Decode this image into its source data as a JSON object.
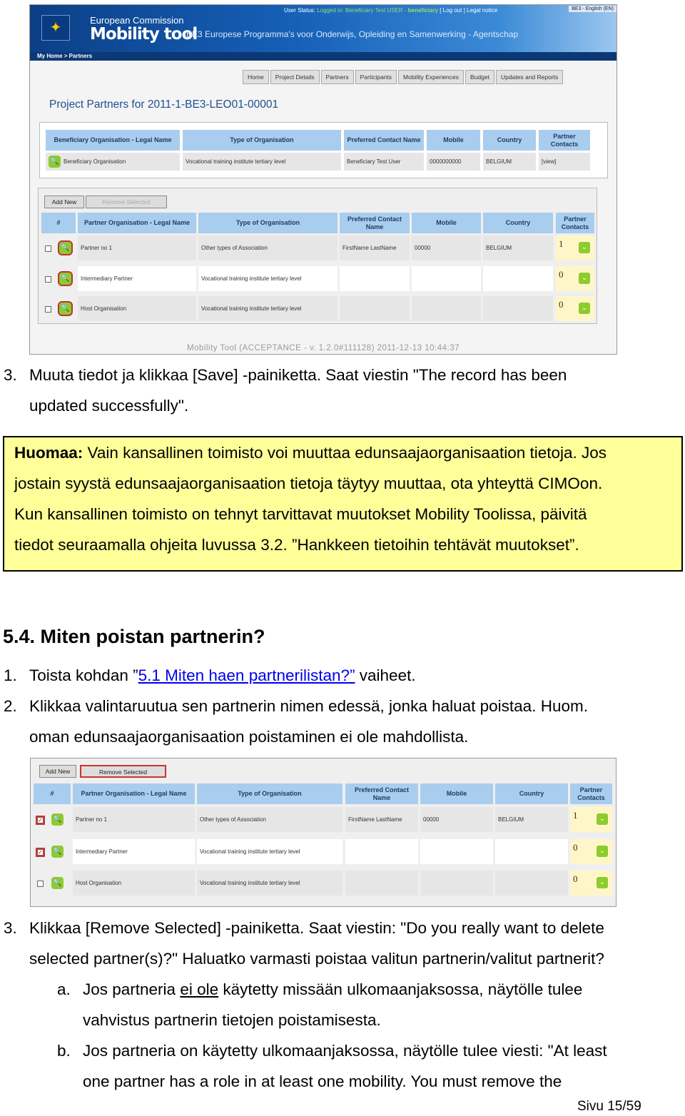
{
  "shot1": {
    "user_status_label": "User Status:",
    "logged_in": "Logged in: Beneficiary Test USER -",
    "user_role": "beneficiary",
    "logout": "[  Log out  ]",
    "legal": "Legal notice",
    "language": "BE3 - English (EN)",
    "ec": "European Commission",
    "app": "Mobility tool",
    "agency": "BE3 Europese Programma's voor Onderwijs, Opleiding en Samenwerking - Agentschap",
    "breadcrumb": "My Home  >  Partners",
    "tabs": [
      "Home",
      "Project Details",
      "Partners",
      "Participants",
      "Mobility Experiences",
      "Budget",
      "Updates and Reports"
    ],
    "title": "Project Partners for 2011-1-BE3-LEO01-00001",
    "beneficiary": {
      "headers": [
        "Beneficiary Organisation - Legal Name",
        "Type of Organisation",
        "Preferred Contact Name",
        "Mobile",
        "Country",
        "Partner Contacts"
      ],
      "row": [
        "Beneficiary Organisation",
        "Vocational training institute tertiary level",
        "Beneficiary Test User",
        "0000000000",
        "BELGIUM",
        "[view]"
      ]
    },
    "add_new": "Add New",
    "remove_selected": "Remove Selected",
    "footer": "Mobility Tool (ACCEPTANCE - v. 1.2.0#111128) 2011-12-13 10:44:37"
  },
  "partners": {
    "headers": [
      "#",
      "Partner Organisation - Legal Name",
      "Type of Organisation",
      "Preferred Contact Name",
      "Mobile",
      "Country",
      "Partner Contacts"
    ],
    "rows": [
      {
        "name": "Partner no 1",
        "type": "Other types of Association",
        "contact": "FirstName LastName",
        "mobile": "00000",
        "country": "BELGIUM",
        "contacts": "1"
      },
      {
        "name": "Intermediary Partner",
        "type": "Vocational training institute tertiary level",
        "contact": "",
        "mobile": "",
        "country": "",
        "contacts": "0"
      },
      {
        "name": "Host Organisation",
        "type": "Vocational training institute tertiary level",
        "contact": "",
        "mobile": "",
        "country": "",
        "contacts": "0"
      }
    ],
    "checked_in_shot2": [
      true,
      true,
      false
    ]
  },
  "text": {
    "s3_num": "3.",
    "s3_l1": "Muuta tiedot ja klikkaa [Save] -painiketta. Saat viestin \"The record has been",
    "s3_l2": "updated successfully\".",
    "note_bold": "Huomaa:",
    "note_l1": " Vain kansallinen toimisto voi muuttaa edunsaajaorganisaation tietoja. Jos",
    "note_l2": "jostain syystä edunsaajaorganisaation tietoja täytyy muuttaa, ota yhteyttä CIMOon.",
    "note_l3": "Kun kansallinen toimisto on tehnyt tarvittavat muutokset Mobility Toolissa, päivitä",
    "note_l4": "tiedot seuraamalla ohjeita luvussa 3.2. ”Hankkeen tietoihin tehtävät muutokset”.",
    "heading": "5.4. Miten poistan partnerin?",
    "i1_num": "1.",
    "i1_pre": "Toista kohdan ”",
    "i1_link": "5.1 Miten haen partnerilistan?”",
    "i1_post": " vaiheet.",
    "i2_num": "2.",
    "i2_l1": "Klikkaa valintaruutua sen partnerin nimen edessä, jonka haluat poistaa. Huom.",
    "i2_l2": "oman edunsaajaorganisaation poistaminen ei ole mahdollista.",
    "i3_num": "3.",
    "i3_l1": "Klikkaa [Remove Selected] -painiketta. Saat viestin: \"Do you really want to delete",
    "i3_l2": "selected partner(s)?\" Haluatko varmasti poistaa valitun partnerin/valitut partnerit?",
    "a_num": "a.",
    "a_pre": "Jos partneria ",
    "a_u": "ei ole",
    "a_post": " käytetty missään ulkomaanjaksossa, näytölle tulee",
    "a_l2": "vahvistus partnerin tietojen poistamisesta.",
    "b_num": "b.",
    "b_l1": "Jos partneria on käytetty ulkomaanjaksossa, näytölle tulee viesti: \"At least",
    "b_l2": "one partner has a role in at least one mobility. You must remove the",
    "page": "Sivu 15/59"
  },
  "colors": {
    "accent_blue": "#1660b8",
    "header_cell": "#a9cdee",
    "note_bg": "#ffff99",
    "icon_green": "#8ccc2c",
    "link": "#0000ee"
  }
}
